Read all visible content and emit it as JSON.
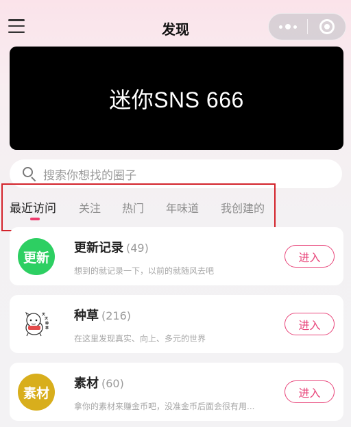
{
  "nav": {
    "title": "发现",
    "menu_icon": "hamburger-menu-icon",
    "more_icon": "more-dots-icon",
    "close_icon": "target-close-icon"
  },
  "banner": {
    "text": "迷你SNS  666"
  },
  "search": {
    "placeholder": "搜索你想找的圈子",
    "icon": "search-icon"
  },
  "tabs": [
    {
      "label": "最近访问",
      "active": true
    },
    {
      "label": "关注"
    },
    {
      "label": "热门"
    },
    {
      "label": "年味道"
    },
    {
      "label": "我创建的"
    }
  ],
  "circles": [
    {
      "avatar_text": "更新",
      "avatar_color": "#2dcf62",
      "name": "更新记录",
      "count": "(49)",
      "desc": "想到的就记录一下，以前的就随风去吧",
      "button": "进入"
    },
    {
      "avatar_text": "",
      "avatar_icon": "cartoon-character-icon",
      "name": "种草",
      "count": "(216)",
      "desc": "在这里发现真实、向上、多元的世界",
      "button": "进入"
    },
    {
      "avatar_text": "素材",
      "avatar_color": "#d8ae1c",
      "name": "素材",
      "count": "(60)",
      "desc": "拿你的素材来赚金币吧，没准金币后面会很有用...",
      "button": "进入"
    }
  ],
  "colors": {
    "accent": "#e8457a",
    "highlight_box": "#d3222a",
    "banner_bg": "#000000"
  }
}
